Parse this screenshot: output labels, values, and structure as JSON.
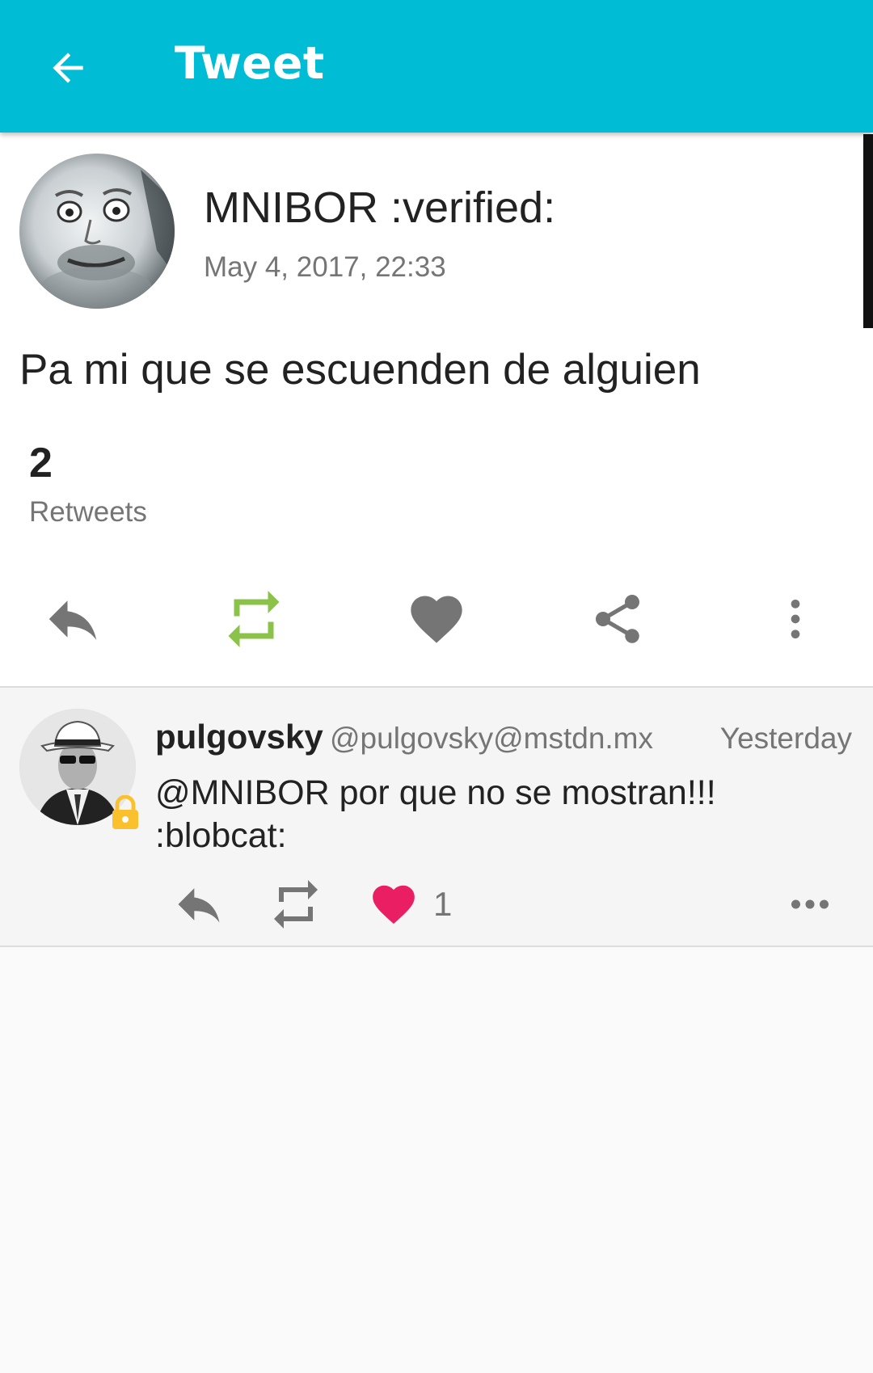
{
  "header": {
    "title": "Tweet",
    "back_icon": "arrow-back-icon",
    "background_color": "#00bcd4"
  },
  "status": {
    "display_name": "MNIBOR :verified:",
    "timestamp": "May 4, 2017, 22:33",
    "content": "Pa mi que se escuenden de alguien",
    "stats": {
      "retweet_count": "2",
      "retweet_label": "Retweets"
    },
    "actions": [
      {
        "name": "reply",
        "icon": "reply-icon",
        "color": "#757575"
      },
      {
        "name": "retweet",
        "icon": "retweet-icon",
        "color": "#8bc34a",
        "active": true
      },
      {
        "name": "favourite",
        "icon": "heart-icon",
        "color": "#757575"
      },
      {
        "name": "share",
        "icon": "share-icon",
        "color": "#757575"
      },
      {
        "name": "more",
        "icon": "more-vertical-icon",
        "color": "#757575"
      }
    ]
  },
  "replies": [
    {
      "display_name": "pulgovsky",
      "handle": "@pulgovsky@mstdn.mx",
      "time": "Yesterday",
      "content": "@MNIBOR por que no se mostran!!! :blobcat:",
      "locked": true,
      "lock_color": "#fbc02d",
      "favourite_count": "1",
      "favourited": true,
      "favourite_color": "#e91e63",
      "actions": [
        "reply-icon",
        "retweet-icon",
        "heart-icon",
        "more-horizontal-icon"
      ]
    }
  ]
}
